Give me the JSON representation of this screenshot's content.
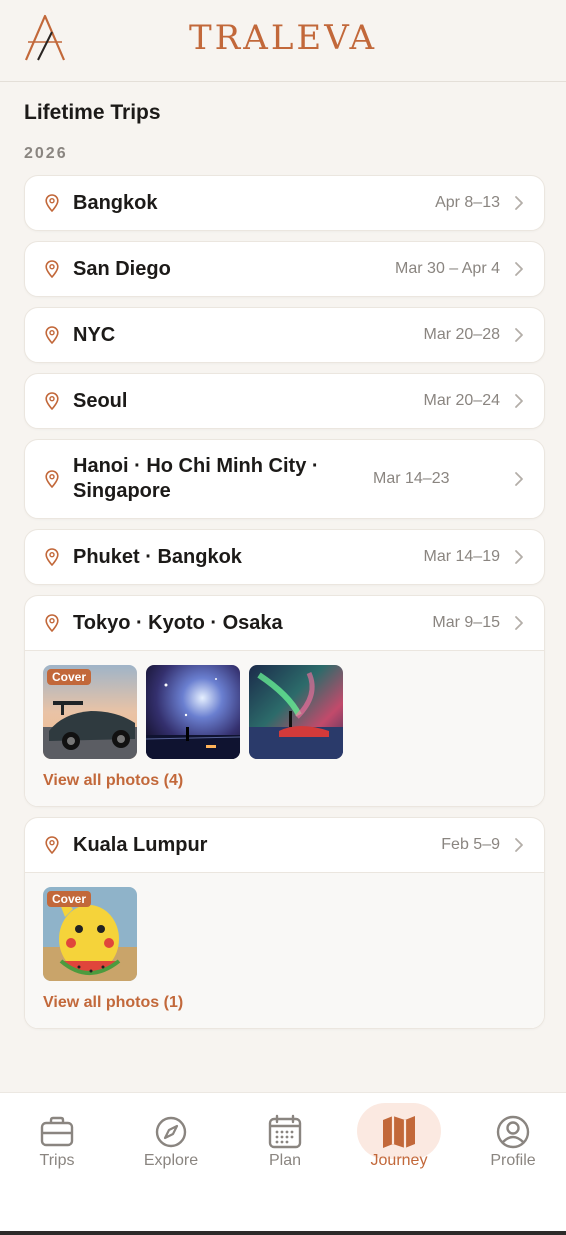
{
  "app": {
    "name": "TRALEVA"
  },
  "page": {
    "title": "Lifetime Trips"
  },
  "year": "2026",
  "trips": [
    {
      "name": "Bangkok",
      "dates": "Apr 8–13"
    },
    {
      "name": "San Diego",
      "dates": "Mar 30 – Apr 4"
    },
    {
      "name": "NYC",
      "dates": "Mar 20–28"
    },
    {
      "name": "Seoul",
      "dates": "Mar 20–24"
    },
    {
      "name": "Hanoi · Ho Chi Minh City · Singapore",
      "dates": "Mar 14–23"
    },
    {
      "name": "Phuket · Bangkok",
      "dates": "Mar 14–19"
    },
    {
      "name": "Tokyo · Kyoto · Osaka",
      "dates": "Mar 9–15",
      "cover_label": "Cover",
      "view_all": "View all photos (4)"
    },
    {
      "name": "Kuala Lumpur",
      "dates": "Feb 5–9",
      "cover_label": "Cover",
      "view_all": "View all photos (1)"
    }
  ],
  "tabs": [
    {
      "label": "Trips",
      "icon": "briefcase-icon"
    },
    {
      "label": "Explore",
      "icon": "compass-icon"
    },
    {
      "label": "Plan",
      "icon": "calendar-icon"
    },
    {
      "label": "Journey",
      "icon": "map-icon",
      "active": true
    },
    {
      "label": "Profile",
      "icon": "user-circle-icon"
    }
  ],
  "colors": {
    "accent": "#c2683a",
    "background": "#f7f4f0",
    "text": "#1c1a18",
    "muted": "#8a8580"
  }
}
